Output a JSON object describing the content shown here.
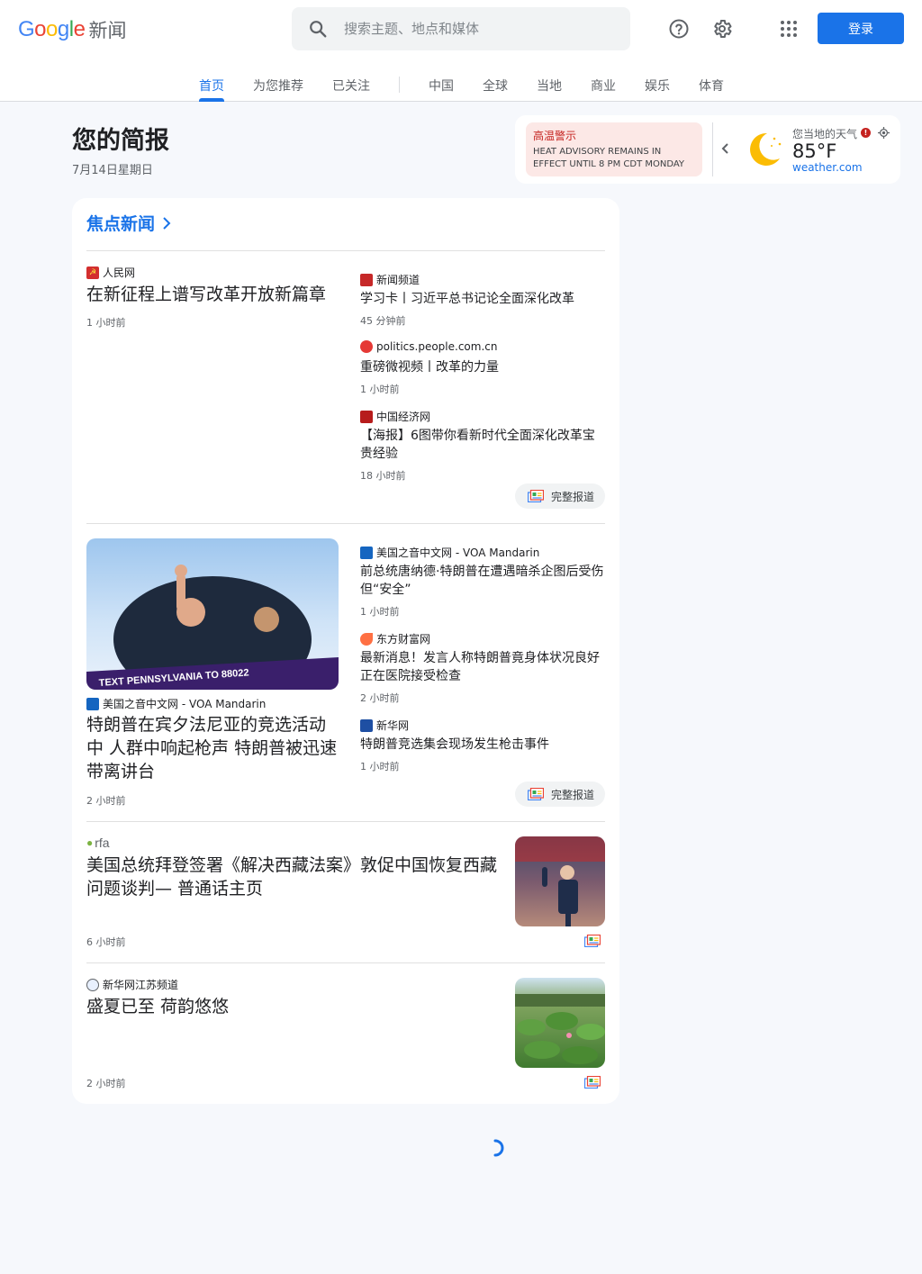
{
  "header": {
    "logo_google": "Google",
    "logo_news": "新闻",
    "search_placeholder": "搜索主题、地点和媒体",
    "signin_label": "登录",
    "icons": [
      "search-icon",
      "help-icon",
      "gear-icon",
      "apps-grid-icon"
    ]
  },
  "tabs": [
    {
      "label": "首页",
      "active": true
    },
    {
      "label": "为您推荐"
    },
    {
      "label": "已关注"
    },
    {
      "label": "中国"
    },
    {
      "label": "全球"
    },
    {
      "label": "当地"
    },
    {
      "label": "商业"
    },
    {
      "label": "娱乐"
    },
    {
      "label": "体育"
    }
  ],
  "briefing": {
    "title": "您的简报",
    "date": "7月14日星期日"
  },
  "weather": {
    "alert_title": "高温警示",
    "alert_text": "HEAT ADVISORY REMAINS IN EFFECT UNTIL 8 PM CDT MONDAY *...",
    "label": "您当地的天气",
    "temp": "85°F",
    "source": "weather.com",
    "colors": {
      "moon": "#fbbc04",
      "alert": "#c5221f"
    }
  },
  "top_stories": {
    "heading": "焦点新闻",
    "full_coverage_label": "完整报道",
    "clusters": [
      {
        "main": {
          "source": "人民网",
          "headline": "在新征程上谱写改革开放新篇章",
          "time": "1 小时前"
        },
        "related": [
          {
            "source": "新闻频道",
            "headline": "学习卡丨习近平总书记论全面深化改革",
            "time": "45 分钟前"
          },
          {
            "source": "politics.people.com.cn",
            "headline": "重磅微视频丨改革的力量",
            "time": "1 小时前"
          },
          {
            "source": "中国经济网",
            "headline": "【海报】6图带你看新时代全面深化改革宝贵经验",
            "time": "18 小时前"
          }
        ]
      },
      {
        "main": {
          "source": "美国之音中文网 - VOA Mandarin",
          "headline": "特朗普在宾夕法尼亚的竞选活动中 人群中响起枪声 特朗普被迅速带离讲台",
          "time": "2 小时前",
          "image_caption": "TEXT PENNSYLVANIA TO 88022"
        },
        "related": [
          {
            "source": "美国之音中文网 - VOA Mandarin",
            "headline": "前总统唐纳德·特朗普在遭遇暗杀企图后受伤但“安全”",
            "time": "1 小时前"
          },
          {
            "source": "东方财富网",
            "headline": "最新消息！发言人称特朗普竟身体状况良好 正在医院接受检查",
            "time": "2 小时前"
          },
          {
            "source": "新华网",
            "headline": "特朗普竞选集会现场发生枪击事件",
            "time": "1 小时前"
          }
        ]
      },
      {
        "main": {
          "source": "rfa",
          "headline": "美国总统拜登签署《解决西藏法案》敦促中国恢复西藏问题谈判— 普通话主页",
          "time": "6 小时前"
        }
      },
      {
        "main": {
          "source": "新华网江苏频道",
          "headline": "盛夏已至 荷韵悠悠",
          "time": "2 小时前"
        }
      }
    ]
  }
}
